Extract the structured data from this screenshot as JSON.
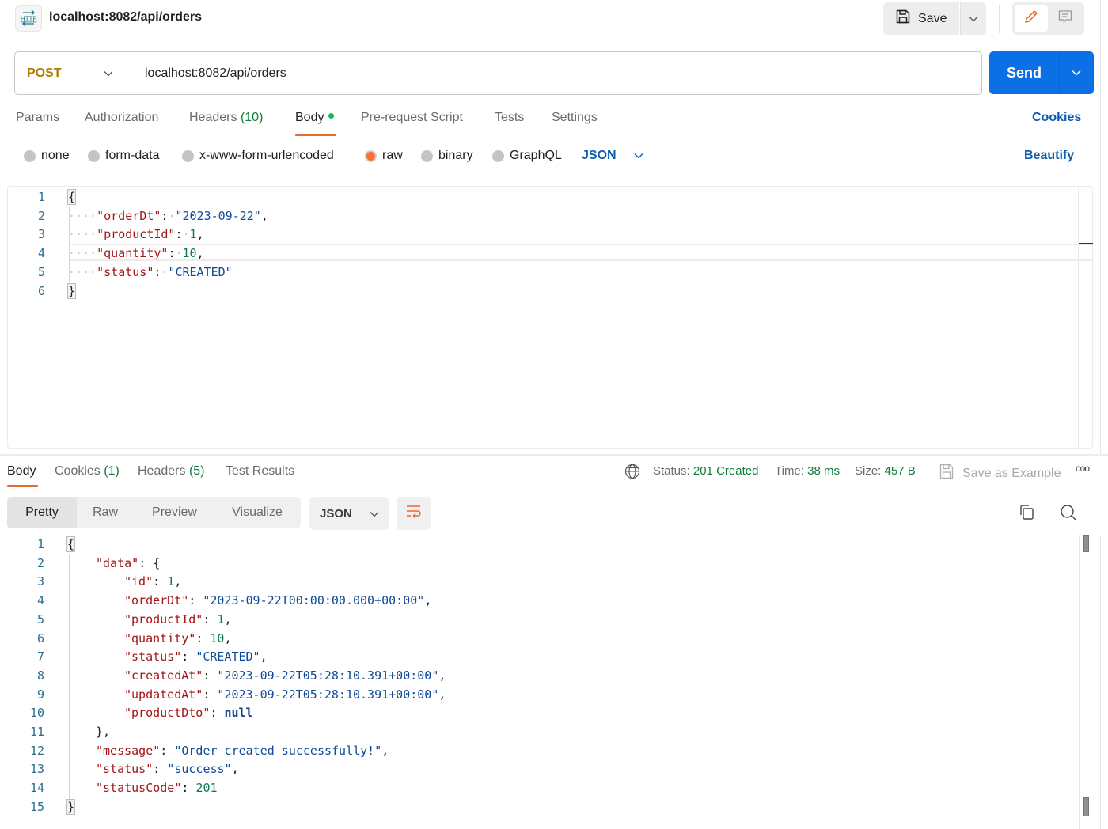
{
  "header": {
    "icon": "http-icon",
    "icon_text": "HTTP",
    "title": "localhost:8082/api/orders",
    "save_label": "Save",
    "save_icon": "floppy-disk-icon",
    "mode_buttons": [
      "pencil-icon",
      "comment-icon"
    ]
  },
  "request": {
    "method": "POST",
    "url": "localhost:8082/api/orders",
    "send_label": "Send",
    "method_color": "#ad7a03",
    "send_color": "#0b6fe5"
  },
  "request_tabs": {
    "items": [
      {
        "label": "Params",
        "count": null
      },
      {
        "label": "Authorization",
        "count": null
      },
      {
        "label": "Headers",
        "count": "(10)"
      },
      {
        "label": "Body",
        "count": null,
        "active": true,
        "dot": true
      },
      {
        "label": "Pre-request Script",
        "count": null
      },
      {
        "label": "Tests",
        "count": null
      },
      {
        "label": "Settings",
        "count": null
      }
    ],
    "cookies_label": "Cookies",
    "accent_color": "#e8692c"
  },
  "body_types": {
    "options": [
      "none",
      "form-data",
      "x-www-form-urlencoded",
      "raw",
      "binary",
      "GraphQL"
    ],
    "selected": "raw",
    "language": "JSON",
    "beautify_label": "Beautify"
  },
  "request_body": {
    "lines": [
      {
        "n": "1",
        "tokens": [
          [
            "brace",
            "{"
          ]
        ]
      },
      {
        "n": "2",
        "tokens": [
          [
            "ws",
            "····"
          ],
          [
            "k",
            "\"orderDt\""
          ],
          [
            "p",
            ":"
          ],
          [
            "ws",
            "·"
          ],
          [
            "s",
            "\"2023-09-22\""
          ],
          [
            "p",
            ","
          ]
        ]
      },
      {
        "n": "3",
        "tokens": [
          [
            "ws",
            "····"
          ],
          [
            "k",
            "\"productId\""
          ],
          [
            "p",
            ":"
          ],
          [
            "ws",
            "·"
          ],
          [
            "n",
            "1"
          ],
          [
            "p",
            ","
          ]
        ]
      },
      {
        "n": "4",
        "tokens": [
          [
            "ws",
            "····"
          ],
          [
            "k",
            "\"quantity\""
          ],
          [
            "p",
            ":"
          ],
          [
            "ws",
            "·"
          ],
          [
            "n",
            "10"
          ],
          [
            "p",
            ","
          ]
        ]
      },
      {
        "n": "5",
        "tokens": [
          [
            "ws",
            "····"
          ],
          [
            "k",
            "\"status\""
          ],
          [
            "p",
            ":"
          ],
          [
            "ws",
            "·"
          ],
          [
            "s",
            "\"CREATED\""
          ]
        ]
      },
      {
        "n": "6",
        "tokens": [
          [
            "brace",
            "}"
          ]
        ]
      }
    ]
  },
  "response_tabs": {
    "items": [
      {
        "label": "Body",
        "count": null,
        "active": true
      },
      {
        "label": "Cookies",
        "count": "(1)"
      },
      {
        "label": "Headers",
        "count": "(5)"
      },
      {
        "label": "Test Results",
        "count": null
      }
    ]
  },
  "response_meta": {
    "status_label": "Status:",
    "status_value": "201 Created",
    "time_label": "Time:",
    "time_value": "38 ms",
    "size_label": "Size:",
    "size_value": "457 B",
    "save_example_label": "Save as Example",
    "more_label": "ooo",
    "success_color": "#0f7b3c"
  },
  "response_view": {
    "modes": [
      "Pretty",
      "Raw",
      "Preview",
      "Visualize"
    ],
    "selected_mode": "Pretty",
    "language": "JSON"
  },
  "response_body": {
    "lines": [
      {
        "n": "1",
        "indent": 0,
        "tokens": [
          [
            "brace",
            "{"
          ]
        ]
      },
      {
        "n": "2",
        "indent": 1,
        "tokens": [
          [
            "k",
            "\"data\""
          ],
          [
            "p",
            ": {"
          ]
        ]
      },
      {
        "n": "3",
        "indent": 2,
        "tokens": [
          [
            "k",
            "\"id\""
          ],
          [
            "p",
            ": "
          ],
          [
            "n",
            "1"
          ],
          [
            "p",
            ","
          ]
        ]
      },
      {
        "n": "4",
        "indent": 2,
        "tokens": [
          [
            "k",
            "\"orderDt\""
          ],
          [
            "p",
            ": "
          ],
          [
            "s",
            "\"2023-09-22T00:00:00.000+00:00\""
          ],
          [
            "p",
            ","
          ]
        ]
      },
      {
        "n": "5",
        "indent": 2,
        "tokens": [
          [
            "k",
            "\"productId\""
          ],
          [
            "p",
            ": "
          ],
          [
            "n",
            "1"
          ],
          [
            "p",
            ","
          ]
        ]
      },
      {
        "n": "6",
        "indent": 2,
        "tokens": [
          [
            "k",
            "\"quantity\""
          ],
          [
            "p",
            ": "
          ],
          [
            "n",
            "10"
          ],
          [
            "p",
            ","
          ]
        ]
      },
      {
        "n": "7",
        "indent": 2,
        "tokens": [
          [
            "k",
            "\"status\""
          ],
          [
            "p",
            ": "
          ],
          [
            "s",
            "\"CREATED\""
          ],
          [
            "p",
            ","
          ]
        ]
      },
      {
        "n": "8",
        "indent": 2,
        "tokens": [
          [
            "k",
            "\"createdAt\""
          ],
          [
            "p",
            ": "
          ],
          [
            "s",
            "\"2023-09-22T05:28:10.391+00:00\""
          ],
          [
            "p",
            ","
          ]
        ]
      },
      {
        "n": "9",
        "indent": 2,
        "tokens": [
          [
            "k",
            "\"updatedAt\""
          ],
          [
            "p",
            ": "
          ],
          [
            "s",
            "\"2023-09-22T05:28:10.391+00:00\""
          ],
          [
            "p",
            ","
          ]
        ]
      },
      {
        "n": "10",
        "indent": 2,
        "tokens": [
          [
            "k",
            "\"productDto\""
          ],
          [
            "p",
            ": "
          ],
          [
            "kw",
            "null"
          ]
        ]
      },
      {
        "n": "11",
        "indent": 1,
        "tokens": [
          [
            "p",
            "},"
          ]
        ]
      },
      {
        "n": "12",
        "indent": 1,
        "tokens": [
          [
            "k",
            "\"message\""
          ],
          [
            "p",
            ": "
          ],
          [
            "s",
            "\"Order created successfully!\""
          ],
          [
            "p",
            ","
          ]
        ]
      },
      {
        "n": "13",
        "indent": 1,
        "tokens": [
          [
            "k",
            "\"status\""
          ],
          [
            "p",
            ": "
          ],
          [
            "s",
            "\"success\""
          ],
          [
            "p",
            ","
          ]
        ]
      },
      {
        "n": "14",
        "indent": 1,
        "tokens": [
          [
            "k",
            "\"statusCode\""
          ],
          [
            "p",
            ": "
          ],
          [
            "n",
            "201"
          ]
        ]
      },
      {
        "n": "15",
        "indent": 0,
        "tokens": [
          [
            "brace",
            "}"
          ]
        ]
      }
    ]
  }
}
